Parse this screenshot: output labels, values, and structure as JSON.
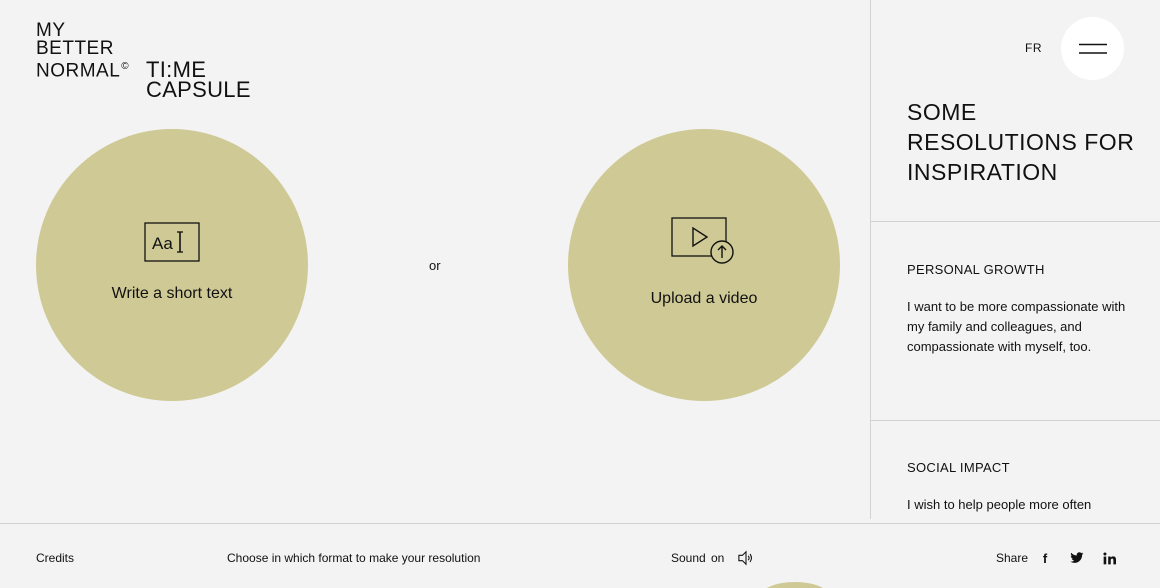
{
  "logo": {
    "line1": "MY",
    "line2": "BETTER",
    "line3": "NORMAL",
    "copyright": "©"
  },
  "product": {
    "line1": "TI:ME",
    "line2": "CAPSULE"
  },
  "options": {
    "text": {
      "label": "Write a short text",
      "icon_text": "Aa"
    },
    "separator": "or",
    "video": {
      "label": "Upload a video"
    }
  },
  "header": {
    "lang": "FR"
  },
  "panel": {
    "title": "SOME RESOLUTIONS FOR INSPIRATION",
    "sections": [
      {
        "heading": "PERSONAL GROWTH",
        "body": "I want to be more compassionate with my family and colleagues, and compassionate with myself, too."
      },
      {
        "heading": "SOCIAL IMPACT",
        "body": "I wish to help people more often"
      }
    ]
  },
  "footer": {
    "credits": "Credits",
    "instruction": "Choose in which format to make your resolution",
    "sound_label": "Sound",
    "sound_state": "on",
    "share": "Share",
    "social_facebook": "f"
  },
  "colors": {
    "accent": "#cfca95",
    "background": "#f3f3f3"
  }
}
